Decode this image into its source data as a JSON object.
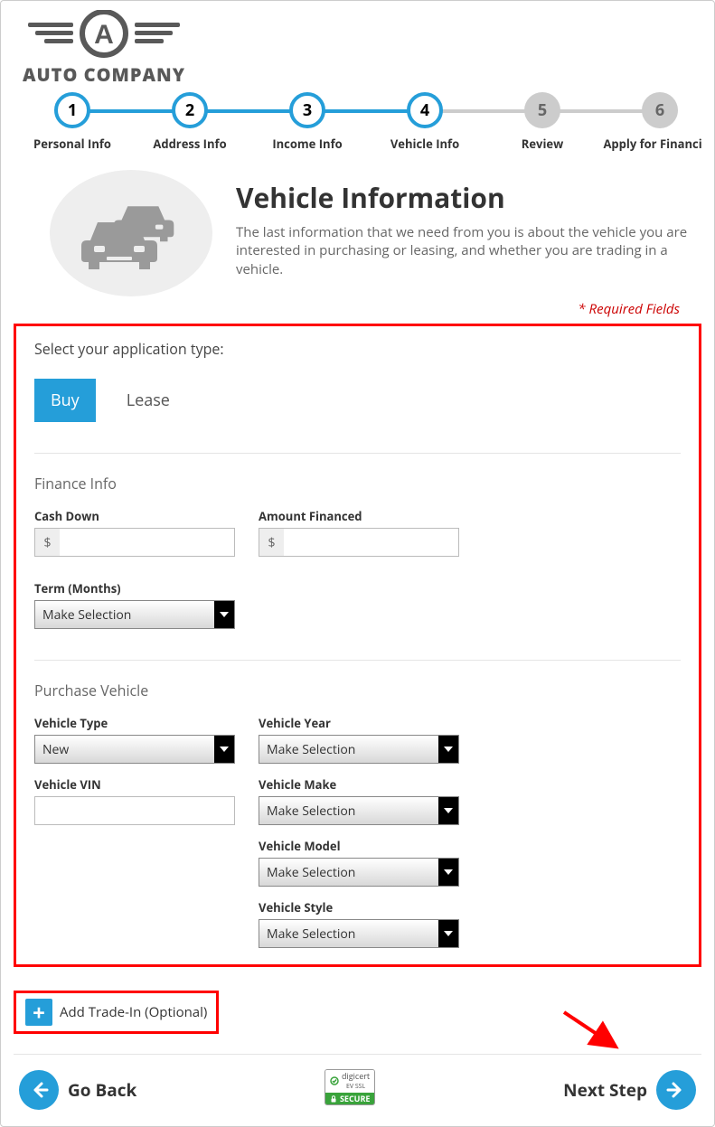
{
  "logo": {
    "text": "AUTO COMPANY"
  },
  "steps": [
    {
      "num": "1",
      "label": "Personal Info",
      "state": "active"
    },
    {
      "num": "2",
      "label": "Address Info",
      "state": "active"
    },
    {
      "num": "3",
      "label": "Income Info",
      "state": "active"
    },
    {
      "num": "4",
      "label": "Vehicle Info",
      "state": "active-last"
    },
    {
      "num": "5",
      "label": "Review",
      "state": "future"
    },
    {
      "num": "6",
      "label": "Apply for Financing",
      "state": "future"
    }
  ],
  "header": {
    "title": "Vehicle Information",
    "subtitle": "The last information that we need from you is about the vehicle you are interested in purchasing or leasing, and whether you are trading in a vehicle.",
    "required": "* Required Fields"
  },
  "form": {
    "appTypePrompt": "Select your application type:",
    "tabs": {
      "buy": "Buy",
      "lease": "Lease"
    },
    "financeTitle": "Finance Info",
    "finance": {
      "cashDownLabel": "Cash Down",
      "cashDownPrefix": "$",
      "cashDownValue": "",
      "amountFinancedLabel": "Amount Financed",
      "amountFinancedPrefix": "$",
      "amountFinancedValue": "",
      "termLabel": "Term (Months)",
      "termValue": "Make Selection"
    },
    "purchaseTitle": "Purchase Vehicle",
    "purchase": {
      "vehicleTypeLabel": "Vehicle Type",
      "vehicleTypeValue": "New",
      "vehicleVinLabel": "Vehicle VIN",
      "vehicleVinValue": "",
      "vehicleYearLabel": "Vehicle Year",
      "vehicleYearValue": "Make Selection",
      "vehicleMakeLabel": "Vehicle Make",
      "vehicleMakeValue": "Make Selection",
      "vehicleModelLabel": "Vehicle Model",
      "vehicleModelValue": "Make Selection",
      "vehicleStyleLabel": "Vehicle Style",
      "vehicleStyleValue": "Make Selection"
    }
  },
  "tradeIn": {
    "label": "Add Trade-In (Optional)"
  },
  "seal": {
    "line1": "digicert",
    "line2": "EV SSL",
    "secure": "SECURE"
  },
  "nav": {
    "back": "Go Back",
    "next": "Next Step"
  }
}
